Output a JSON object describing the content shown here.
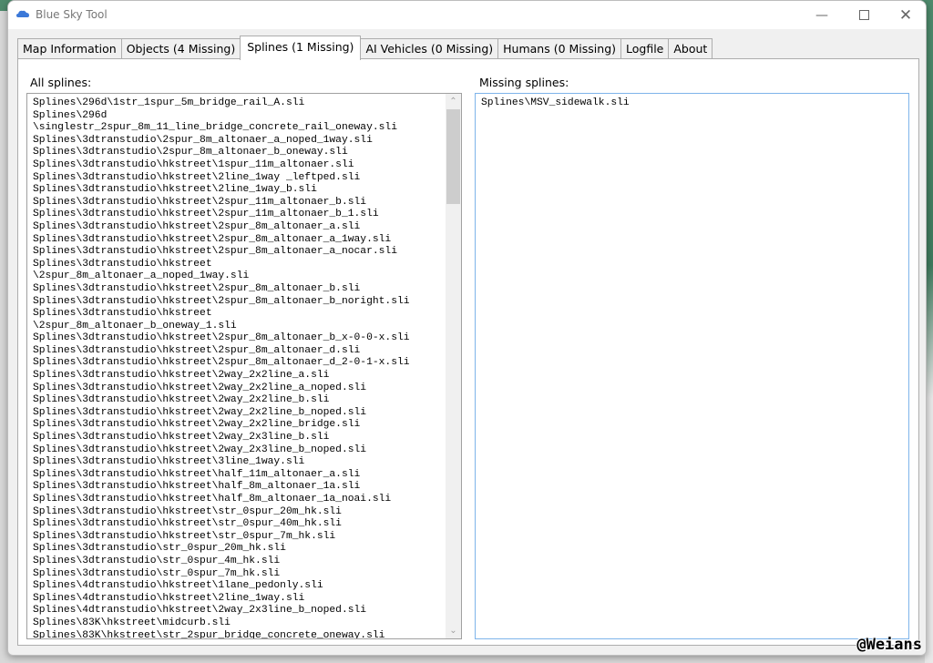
{
  "window": {
    "title": "Blue Sky Tool",
    "minimize_icon": "minimize-icon",
    "maximize_icon": "maximize-icon",
    "close_icon": "close-icon"
  },
  "tabs": [
    {
      "label": "Map Information",
      "active": false
    },
    {
      "label": "Objects (4 Missing)",
      "active": false
    },
    {
      "label": "Splines (1 Missing)",
      "active": true
    },
    {
      "label": "AI Vehicles (0 Missing)",
      "active": false
    },
    {
      "label": "Humans (0 Missing)",
      "active": false
    },
    {
      "label": "Logfile",
      "active": false
    },
    {
      "label": "About",
      "active": false
    }
  ],
  "splines": {
    "all_label": "All splines:",
    "all_text": "Splines\\296d\\1str_1spur_5m_bridge_rail_A.sli\nSplines\\296d\n\\singlestr_2spur_8m_11_line_bridge_concrete_rail_oneway.sli\nSplines\\3dtranstudio\\2spur_8m_altonaer_a_noped_1way.sli\nSplines\\3dtranstudio\\2spur_8m_altonaer_b_oneway.sli\nSplines\\3dtranstudio\\hkstreet\\1spur_11m_altonaer.sli\nSplines\\3dtranstudio\\hkstreet\\2line_1way _leftped.sli\nSplines\\3dtranstudio\\hkstreet\\2line_1way_b.sli\nSplines\\3dtranstudio\\hkstreet\\2spur_11m_altonaer_b.sli\nSplines\\3dtranstudio\\hkstreet\\2spur_11m_altonaer_b_1.sli\nSplines\\3dtranstudio\\hkstreet\\2spur_8m_altonaer_a.sli\nSplines\\3dtranstudio\\hkstreet\\2spur_8m_altonaer_a_1way.sli\nSplines\\3dtranstudio\\hkstreet\\2spur_8m_altonaer_a_nocar.sli\nSplines\\3dtranstudio\\hkstreet\n\\2spur_8m_altonaer_a_noped_1way.sli\nSplines\\3dtranstudio\\hkstreet\\2spur_8m_altonaer_b.sli\nSplines\\3dtranstudio\\hkstreet\\2spur_8m_altonaer_b_noright.sli\nSplines\\3dtranstudio\\hkstreet\n\\2spur_8m_altonaer_b_oneway_1.sli\nSplines\\3dtranstudio\\hkstreet\\2spur_8m_altonaer_b_x-0-0-x.sli\nSplines\\3dtranstudio\\hkstreet\\2spur_8m_altonaer_d.sli\nSplines\\3dtranstudio\\hkstreet\\2spur_8m_altonaer_d_2-0-1-x.sli\nSplines\\3dtranstudio\\hkstreet\\2way_2x2line_a.sli\nSplines\\3dtranstudio\\hkstreet\\2way_2x2line_a_noped.sli\nSplines\\3dtranstudio\\hkstreet\\2way_2x2line_b.sli\nSplines\\3dtranstudio\\hkstreet\\2way_2x2line_b_noped.sli\nSplines\\3dtranstudio\\hkstreet\\2way_2x2line_bridge.sli\nSplines\\3dtranstudio\\hkstreet\\2way_2x3line_b.sli\nSplines\\3dtranstudio\\hkstreet\\2way_2x3line_b_noped.sli\nSplines\\3dtranstudio\\hkstreet\\3line_1way.sli\nSplines\\3dtranstudio\\hkstreet\\half_11m_altonaer_a.sli\nSplines\\3dtranstudio\\hkstreet\\half_8m_altonaer_1a.sli\nSplines\\3dtranstudio\\hkstreet\\half_8m_altonaer_1a_noai.sli\nSplines\\3dtranstudio\\hkstreet\\str_0spur_20m_hk.sli\nSplines\\3dtranstudio\\hkstreet\\str_0spur_40m_hk.sli\nSplines\\3dtranstudio\\hkstreet\\str_0spur_7m_hk.sli\nSplines\\3dtranstudio\\str_0spur_20m_hk.sli\nSplines\\3dtranstudio\\str_0spur_4m_hk.sli\nSplines\\3dtranstudio\\str_0spur_7m_hk.sli\nSplines\\4dtranstudio\\hkstreet\\1lane_pedonly.sli\nSplines\\4dtranstudio\\hkstreet\\2line_1way.sli\nSplines\\4dtranstudio\\hkstreet\\2way_2x3line_b_noped.sli\nSplines\\83K\\hkstreet\\midcurb.sli\nSplines\\83K\\hkstreet\\str_2spur_bridge_concrete_oneway.sli",
    "missing_label": "Missing splines:",
    "missing_text": "Splines\\MSV_sidewalk.sli",
    "scroll_position": 0
  },
  "watermark": "@Weians",
  "colors": {
    "accent": "#4a8fe7",
    "focus_border": "#7eb4ea"
  }
}
